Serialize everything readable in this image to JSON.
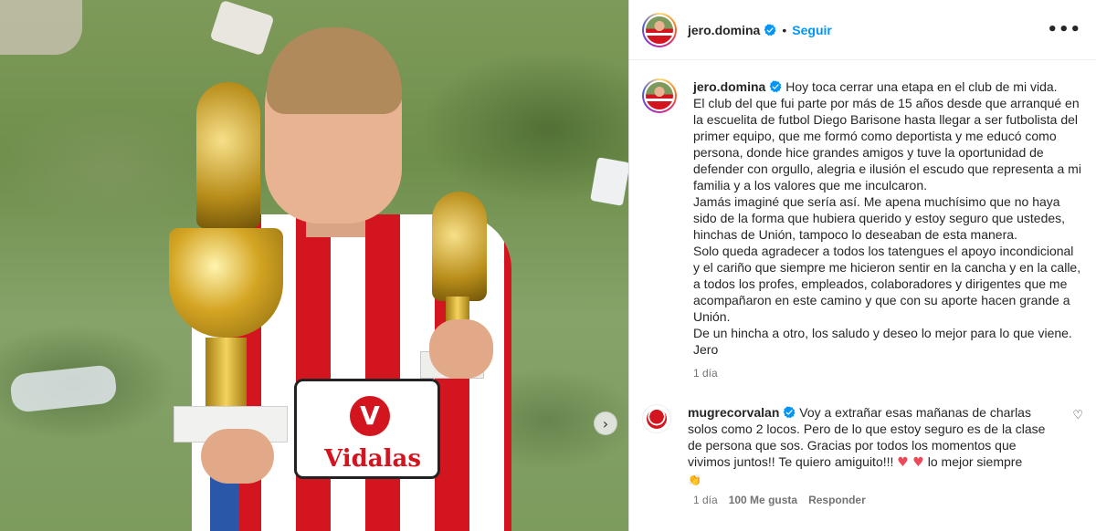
{
  "post": {
    "image_alt": "Niño con camiseta rojiblanca sosteniendo dos trofeos dorados sobre el pasto",
    "shirt_logo_letter": "V",
    "shirt_logo_text": "Vidalas"
  },
  "header": {
    "username": "jero.domina",
    "follow_label": "Seguir",
    "more_label": "•••"
  },
  "caption": {
    "username": "jero.domina",
    "lines": [
      "Hoy toca cerrar una etapa en el club de mi vida.",
      "El club del que fui parte por más de 15 años desde que arranqué en la escuelita de futbol Diego Barisone hasta llegar a ser futbolista del primer equipo, que me formó como deportista y me educó como persona, donde hice grandes amigos y tuve la oportunidad de defender con orgullo, alegria e ilusión el escudo que representa a mi familia y a los valores que me inculcaron.",
      "Jamás imaginé que sería así. Me apena muchísimo que no haya sido de la forma que hubiera querido y estoy seguro que ustedes, hinchas de Unión, tampoco lo deseaban de esta manera.",
      "Solo queda agradecer a todos los tatengues el apoyo incondicional y el cariño que siempre me hicieron sentir en la cancha y en la calle, a todos los profes, empleados, colaboradores y dirigentes que me acompañaron en este camino y que con su aporte hacen grande a Unión.",
      "De un hincha a otro, los saludo y deseo lo mejor para lo que viene.",
      "Jero"
    ],
    "time": "1 día"
  },
  "comment": {
    "username": "mugrecorvalan",
    "text": "Voy a extrañar esas mañanas de charlas solos como 2 locos. Pero de lo que estoy seguro es de la clase de persona que sos. Gracias por todos los momentos que vivimos juntos!! Te quiero amiguito!!! ",
    "hearts": "♥ ♥",
    "text_end": " lo mejor siempre",
    "clap": "👏",
    "time": "1 día",
    "likes": "100 Me gusta",
    "reply_label": "Responder",
    "like_icon": "♡"
  },
  "nav": {
    "next_icon": "›"
  }
}
